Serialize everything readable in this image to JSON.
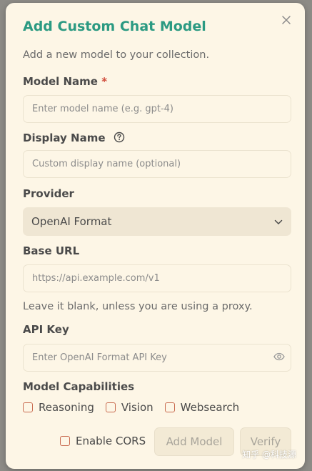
{
  "dialog": {
    "title": "Add Custom Chat Model",
    "subtitle": "Add a new model to your collection.",
    "close_icon": "close-icon"
  },
  "fields": {
    "model_name": {
      "label": "Model Name",
      "required_mark": "*",
      "placeholder": "Enter model name (e.g. gpt-4)",
      "value": ""
    },
    "display_name": {
      "label": "Display Name",
      "help_icon": "help-circle-icon",
      "placeholder": "Custom display name (optional)",
      "value": ""
    },
    "provider": {
      "label": "Provider",
      "selected": "OpenAI Format",
      "chevron_icon": "chevron-down-icon"
    },
    "base_url": {
      "label": "Base URL",
      "placeholder": "https://api.example.com/v1",
      "value": "",
      "hint": "Leave it blank, unless you are using a proxy."
    },
    "api_key": {
      "label": "API Key",
      "placeholder": "Enter OpenAI Format API Key",
      "value": "",
      "eye_icon": "eye-icon"
    }
  },
  "capabilities": {
    "label": "Model Capabilities",
    "options": [
      {
        "label": "Reasoning",
        "checked": false
      },
      {
        "label": "Vision",
        "checked": false
      },
      {
        "label": "Websearch",
        "checked": false
      }
    ]
  },
  "footer": {
    "enable_cors_label": "Enable CORS",
    "enable_cors_checked": false,
    "add_model_label": "Add Model",
    "verify_label": "Verify"
  },
  "watermark": "知乎 @科技源",
  "colors": {
    "accent": "#2b9a82",
    "required": "#d04a3a",
    "checkbox_border": "#c86a4f",
    "background": "#fdf6e6"
  }
}
